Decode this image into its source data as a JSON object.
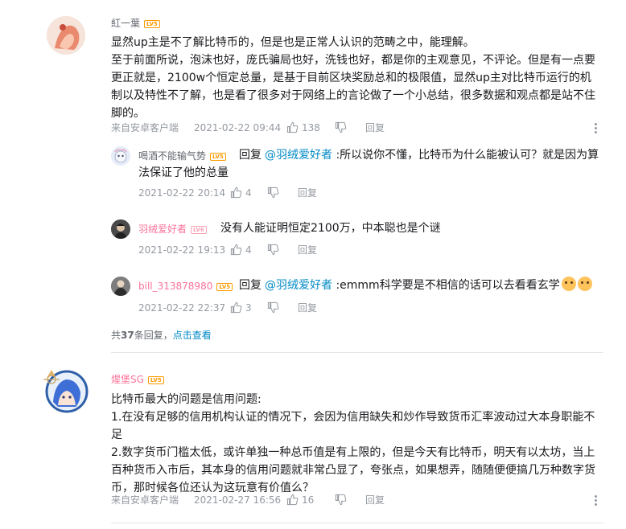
{
  "comment1": {
    "username": "紅一葉",
    "level": "LV5",
    "paragraphs": [
      "显然up主是不了解比特币的，但是也是正常人认识的范畴之中，能理解。",
      "至于前面所说，泡沫也好，庞氏骗局也好，洗钱也好，都是你的主观意见，不评论。但是有一点要更正就是，2100w个恒定总量，是基于目前区块奖励总和的极限值，显然up主对比特币运行的机制以及特性不了解，也是看了很多对于网络上的言论做了一个小总结，很多数据和观点都是站不住脚的。"
    ],
    "source": "来自安卓客户端",
    "time": "2021-02-22 09:44",
    "likes": "138",
    "reply_label": "回复"
  },
  "replies": [
    {
      "username": "喝酒不能输气势",
      "level": "LV5",
      "reply_prefix": "回复",
      "at": "@羽绒爱好者",
      "text": " :所以说你不懂，比特币为什么能被认可？就是因为算法保证了他的总量",
      "time": "2021-02-22 20:14",
      "likes": "4",
      "reply_label": "回复"
    },
    {
      "username": "羽绒爱好者",
      "level": "LV6",
      "text": "没有人能证明恒定2100万，中本聪也是个谜",
      "time": "2021-02-22 19:13",
      "likes": "4",
      "reply_label": "回复"
    },
    {
      "username": "bill_313878980",
      "level": "LV5",
      "reply_prefix": "回复",
      "at": "@羽绒爱好者",
      "text": " :emmm科学要是不相信的话可以去看看玄学",
      "time": "2021-02-22 22:37",
      "likes": "3",
      "reply_label": "回复"
    }
  ],
  "more_replies": {
    "prefix": "共",
    "count": "37",
    "suffix": "条回复，",
    "link": "点击查看"
  },
  "comment2": {
    "username": "煋堡SG",
    "level": "LV5",
    "paragraphs": [
      "比特币最大的问题是信用问题:",
      "1.在没有足够的信用机构认证的情况下，会因为信用缺失和炒作导致货币汇率波动过大本身职能不足",
      "2.数字货币门槛太低，或许单独一种总币值是有上限的，但是今天有比特币，明天有以太坊，当上百种货币入市后，其本身的信用问题就非常凸显了，夸张点，如果想弄，随随便便搞几万种数字货币，那时候各位还认为这玩意有价值么？"
    ],
    "source": "来自安卓客户端",
    "time": "2021-02-27 16:56",
    "likes": "16",
    "reply_label": "回复"
  },
  "colors": {
    "link": "#008ac5",
    "vip_name": "#fb7299",
    "meta": "#9499a0",
    "level_badge": "#ff9a00"
  }
}
